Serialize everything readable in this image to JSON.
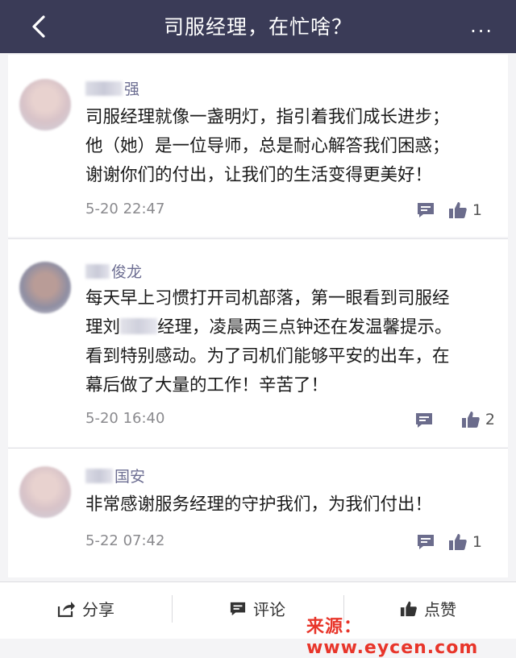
{
  "header": {
    "title": "司服经理，在忙啥？",
    "more": "..."
  },
  "comments": [
    {
      "name_suffix": "强",
      "text": "司服经理就像一盏明灯，指引着我们成长进步；\n他（她）是一位导师，总是耐心解答我们困惑；\n谢谢你们的付出，让我们的生活变得更美好！",
      "time": "5-20 22:47",
      "likes": "1"
    },
    {
      "name_suffix": "俊龙",
      "text_a": "每天早上习惯打开司机部落，第一眼看到司服经\n理刘",
      "text_b": "经理，凌晨两三点钟还在发温馨提示。\n看到特别感动。为了司机们能够平安的出车，在\n幕后做了大量的工作！辛苦了！",
      "time": "5-20 16:40",
      "likes": "2"
    },
    {
      "name_suffix": "国安",
      "text": "非常感谢服务经理的守护我们，为我们付出！",
      "time": "5-22 07:42",
      "likes": "1"
    }
  ],
  "bottom": {
    "share": "分享",
    "comment": "评论",
    "like": "点赞"
  },
  "watermark": "来源：www.eycen.com",
  "colors": {
    "topbar": "#3a3b57",
    "username": "#6e6f93",
    "icon": "#6b6c8c"
  }
}
